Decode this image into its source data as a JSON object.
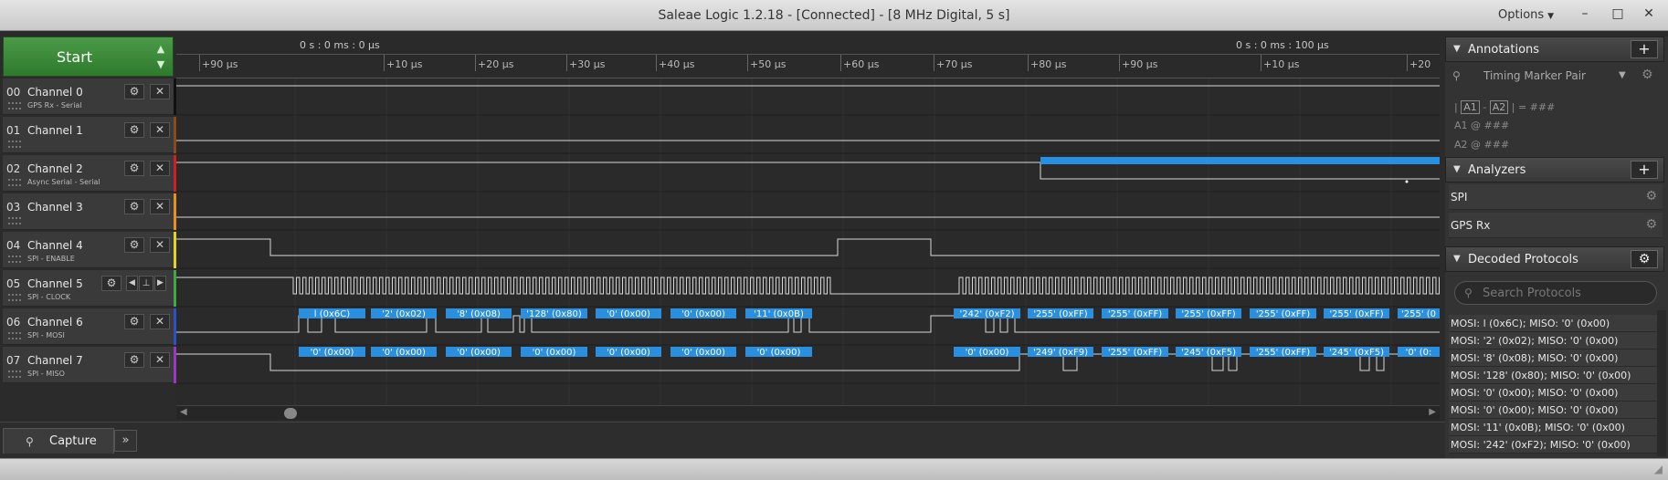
{
  "window": {
    "title": "Saleae Logic 1.2.18 - [Connected] - [8 MHz Digital, 5 s]",
    "options_label": "Options"
  },
  "toolbar": {
    "start_label": "Start"
  },
  "ruler": {
    "absolute": [
      {
        "label": "0 s : 0 ms : 0 μs"
      },
      {
        "label": "0 s : 0 ms : 100 μs"
      }
    ],
    "ticks": [
      "+90 μs",
      "+10 μs",
      "+20 μs",
      "+30 μs",
      "+40 μs",
      "+50 μs",
      "+60 μs",
      "+70 μs",
      "+80 μs",
      "+90 μs",
      "+10 μs",
      "+20"
    ]
  },
  "channels": [
    {
      "num": "00",
      "name": "Channel 0",
      "sub": "GPS Rx - Serial",
      "color": "#111111"
    },
    {
      "num": "01",
      "name": "Channel 1",
      "sub": "",
      "color": "#8a4a1e"
    },
    {
      "num": "02",
      "name": "Channel 2",
      "sub": "Async Serial - Serial",
      "color": "#d21f1f"
    },
    {
      "num": "03",
      "name": "Channel 3",
      "sub": "",
      "color": "#e8901a"
    },
    {
      "num": "04",
      "name": "Channel 4",
      "sub": "SPI - ENABLE",
      "color": "#e6d41a"
    },
    {
      "num": "05",
      "name": "Channel 5",
      "sub": "SPI - CLOCK",
      "color": "#3faa3f"
    },
    {
      "num": "06",
      "name": "Channel 6",
      "sub": "SPI - MOSI",
      "color": "#2a52c8"
    },
    {
      "num": "07",
      "name": "Channel 7",
      "sub": "SPI - MISO",
      "color": "#9a36c8"
    }
  ],
  "mosi_labels": [
    "l (0x6C)",
    "'2' (0x02)",
    "'8' (0x08)",
    "'128' (0x80)",
    "'0' (0x00)",
    "'0' (0x00)",
    "'11' (0x0B)",
    "'242' (0xF2)",
    "'255' (0xFF)",
    "'255' (0xFF)",
    "'255' (0xFF)",
    "'255' (0xFF)",
    "'255' (0xFF)",
    "'255' (0"
  ],
  "miso_labels": [
    "'0' (0x00)",
    "'0' (0x00)",
    "'0' (0x00)",
    "'0' (0x00)",
    "'0' (0x00)",
    "'0' (0x00)",
    "'0' (0x00)",
    "'0' (0x00)",
    "'249' (0xF9)",
    "'255' (0xFF)",
    "'245' (0xF5)",
    "'255' (0xFF)",
    "'245' (0xF5)",
    "'0' (0:"
  ],
  "annotations": {
    "title": "Annotations",
    "marker": "Timing Marker Pair",
    "a1": "A1",
    "a2": "A2",
    "diff_value": "= ###",
    "a1_line": "A1  @  ###",
    "a2_line": "A2  @  ###"
  },
  "analyzers": {
    "title": "Analyzers",
    "items": [
      "SPI",
      "GPS Rx"
    ]
  },
  "decoded": {
    "title": "Decoded Protocols",
    "search_placeholder": "Search Protocols",
    "items": [
      "MOSI: l (0x6C);  MISO: '0' (0x00)",
      "MOSI: '2' (0x02);  MISO: '0' (0x00)",
      "MOSI: '8' (0x08);  MISO: '0' (0x00)",
      "MOSI: '128' (0x80);  MISO: '0' (0x00)",
      "MOSI: '0' (0x00);  MISO: '0' (0x00)",
      "MOSI: '0' (0x00);  MISO: '0' (0x00)",
      "MOSI: '11' (0x0B);  MISO: '0' (0x00)",
      "MOSI: '242' (0xF2);  MISO: '0' (0x00)"
    ]
  },
  "bottom": {
    "capture_label": "Capture"
  },
  "colors": {
    "accent": "#2b8fe0",
    "start": "#3d8a3b"
  }
}
